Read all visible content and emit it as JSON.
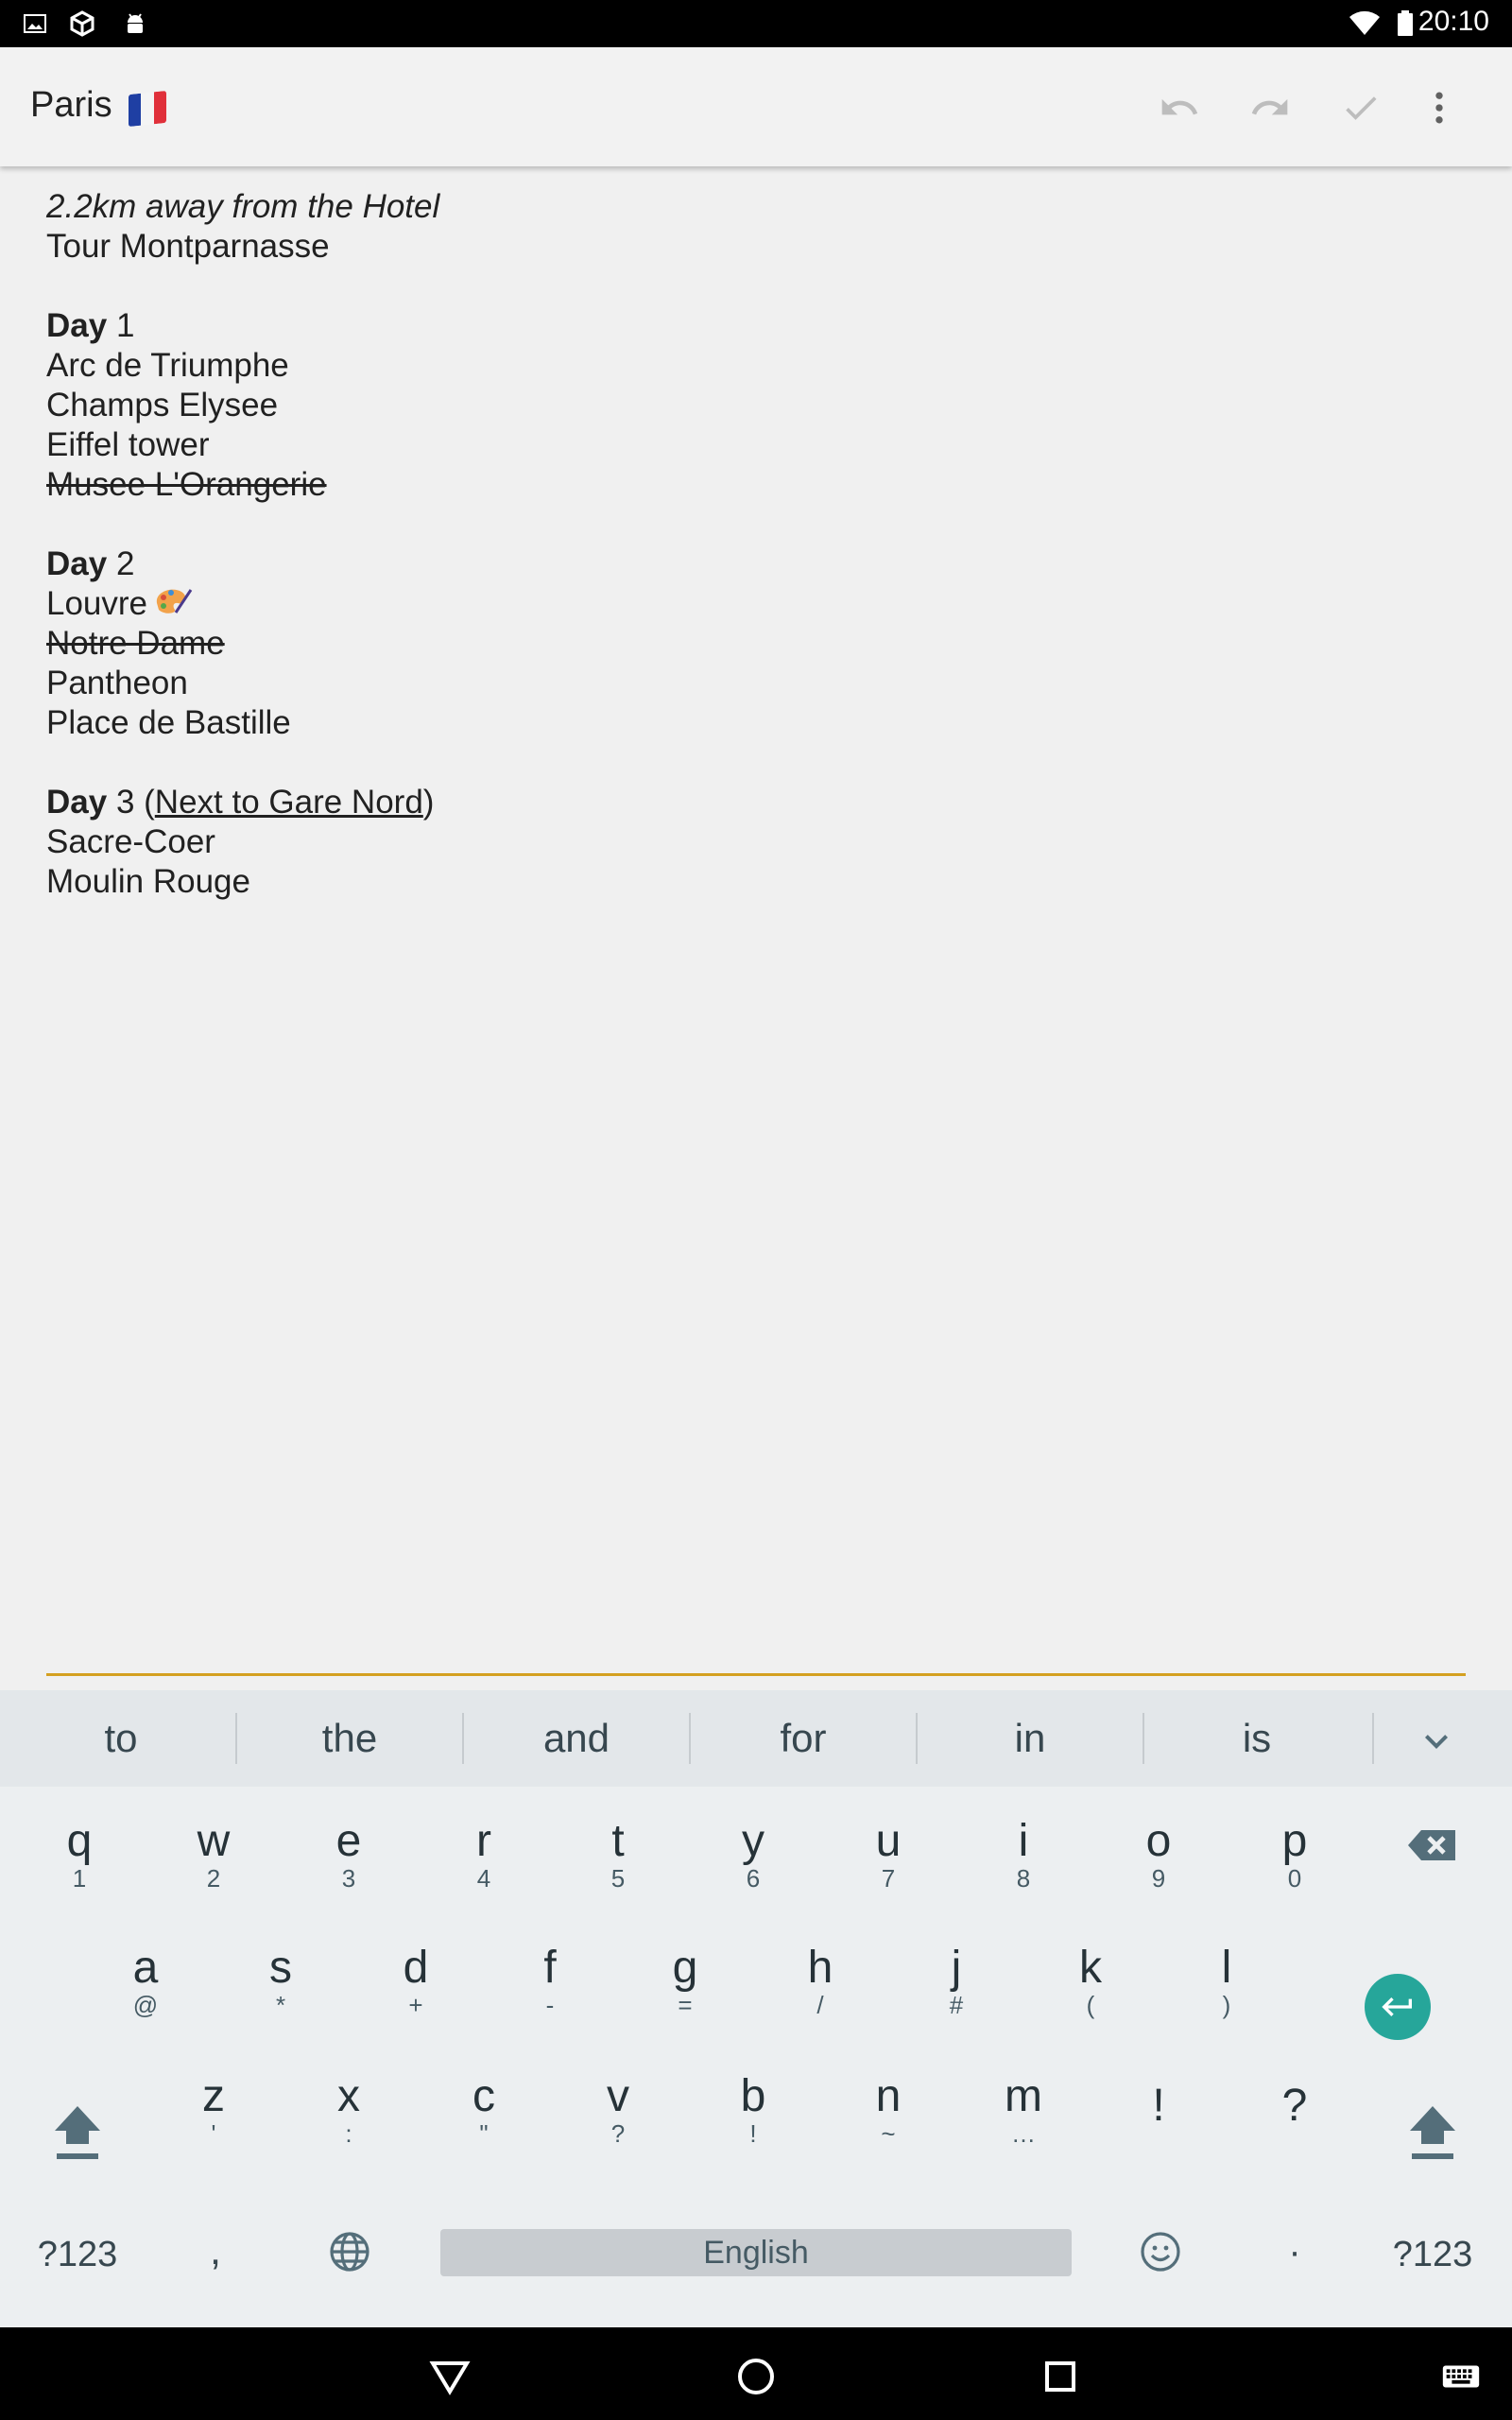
{
  "status_bar": {
    "time": "20:10",
    "left_icons": [
      "image-icon",
      "box-icon",
      "android-icon"
    ],
    "right_icons": [
      "wifi-icon",
      "battery-icon"
    ]
  },
  "app_bar": {
    "title": "Paris",
    "title_emoji": "french-flag-icon",
    "actions": [
      "undo-icon",
      "redo-icon",
      "check-icon",
      "more-vert-icon"
    ]
  },
  "note": {
    "distance": "2.2km away from the Hotel",
    "hotel": "Tour Montparnasse",
    "day_label": "Day",
    "day1": {
      "num": " 1",
      "items": [
        "Arc de Triumphe",
        "Champs Elysee",
        "Eiffel tower"
      ],
      "struck": "Musee L'Orangerie"
    },
    "day2": {
      "num": " 2",
      "first": "Louvre",
      "struck": "Notre Dame",
      "items": [
        "Pantheon",
        "Place de Bastille"
      ]
    },
    "day3": {
      "num": " 3 (",
      "link": "Next to Gare Nord",
      "close": ")",
      "items": [
        "Sacre-Coer",
        "Moulin Rouge"
      ]
    }
  },
  "keyboard": {
    "suggestions": [
      "to",
      "the",
      "and",
      "for",
      "in",
      "is"
    ],
    "row1": [
      {
        "k": "q",
        "s": "1"
      },
      {
        "k": "w",
        "s": "2"
      },
      {
        "k": "e",
        "s": "3"
      },
      {
        "k": "r",
        "s": "4"
      },
      {
        "k": "t",
        "s": "5"
      },
      {
        "k": "y",
        "s": "6"
      },
      {
        "k": "u",
        "s": "7"
      },
      {
        "k": "i",
        "s": "8"
      },
      {
        "k": "o",
        "s": "9"
      },
      {
        "k": "p",
        "s": "0"
      }
    ],
    "row2": [
      {
        "k": "a",
        "s": "@"
      },
      {
        "k": "s",
        "s": "*"
      },
      {
        "k": "d",
        "s": "+"
      },
      {
        "k": "f",
        "s": "-"
      },
      {
        "k": "g",
        "s": "="
      },
      {
        "k": "h",
        "s": "/"
      },
      {
        "k": "j",
        "s": "#"
      },
      {
        "k": "k",
        "s": "("
      },
      {
        "k": "l",
        "s": ")"
      }
    ],
    "row3": [
      {
        "k": "z",
        "s": "'"
      },
      {
        "k": "x",
        "s": ":"
      },
      {
        "k": "c",
        "s": "\""
      },
      {
        "k": "v",
        "s": "?"
      },
      {
        "k": "b",
        "s": "!"
      },
      {
        "k": "n",
        "s": "~"
      },
      {
        "k": "m",
        "s": "…"
      },
      {
        "k": "!",
        "s": ""
      },
      {
        "k": "?",
        "s": ""
      }
    ],
    "symbols_label": "?123",
    "comma": ",",
    "space_label": "English",
    "period": "·",
    "accent_color": "#26a69a"
  },
  "colors": {
    "underline": "#d4a020",
    "status_bar": "#000000"
  }
}
